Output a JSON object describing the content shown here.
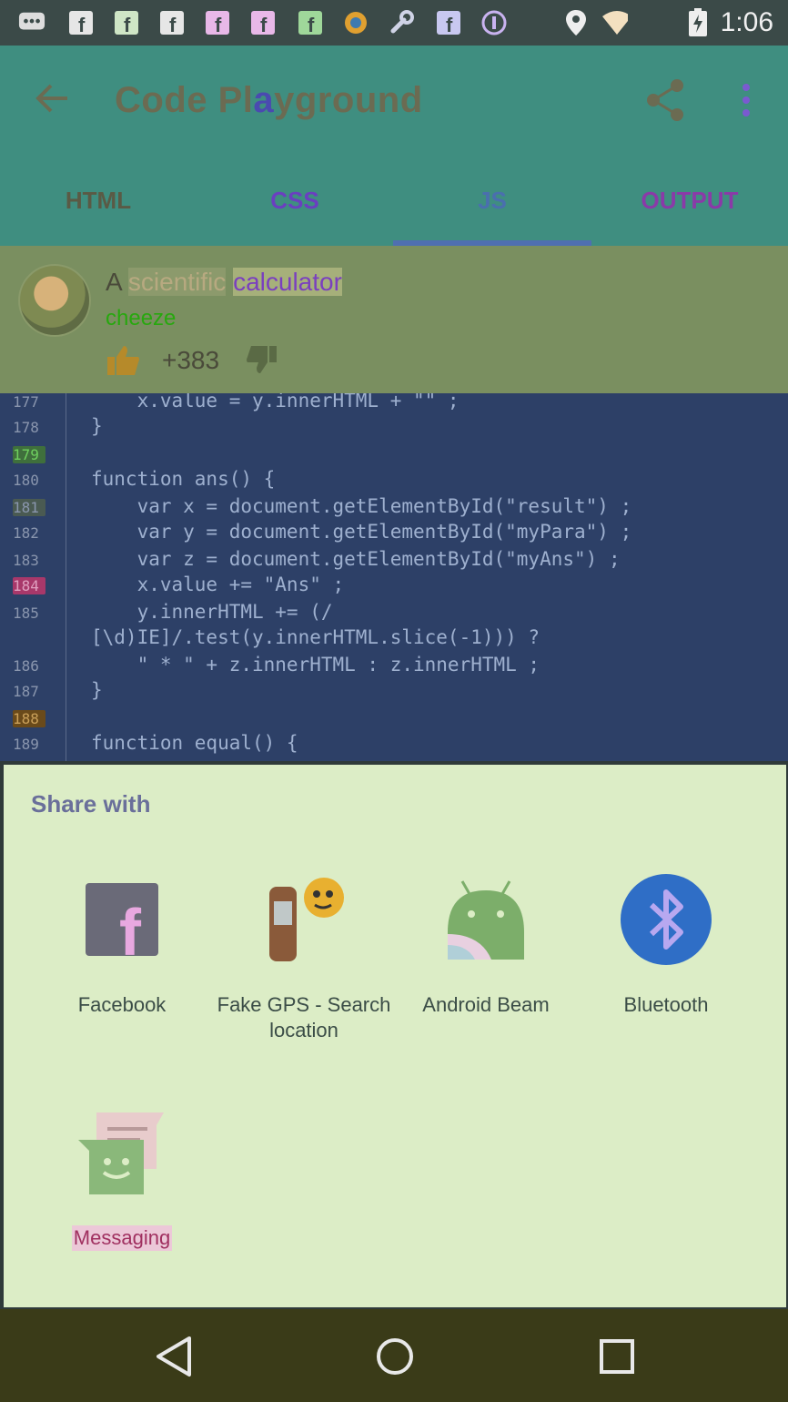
{
  "status_bar": {
    "time": "1:06",
    "notification_icons": [
      "chat-icon",
      "facebook-icon",
      "facebook-icon",
      "facebook-icon",
      "facebook-icon",
      "facebook-icon",
      "gear-app-icon",
      "wrench-icon",
      "facebook-icon",
      "tor-icon"
    ],
    "system_icons": [
      "location-icon",
      "wifi-icon",
      "battery-charging-icon"
    ]
  },
  "app_bar": {
    "title_part1": "Code Pl",
    "title_highlight": "a",
    "title_part2": "yground",
    "tabs": [
      {
        "label": "HTML",
        "color": "#5a5a45"
      },
      {
        "label": "CSS",
        "color": "#6a3fc0"
      },
      {
        "label": "JS",
        "color": "#4a6fae"
      },
      {
        "label": "OUTPUT",
        "color": "#8a3aa8"
      }
    ],
    "active_tab": "JS"
  },
  "post": {
    "title_prefix": "A ",
    "title_word1": "scientific",
    "title_word2": "calculator",
    "author": "cheeze",
    "votes": "+383"
  },
  "editor": {
    "lines": [
      {
        "no": "177",
        "code": "    x.value = y.innerHTML + \"\" ;"
      },
      {
        "no": "178",
        "code": "}"
      },
      {
        "no": "179",
        "code": ""
      },
      {
        "no": "180",
        "code": "function ans() {"
      },
      {
        "no": "181",
        "code": "    var x = document.getElementById(\"result\") ;"
      },
      {
        "no": "182",
        "code": "    var y = document.getElementById(\"myPara\") ;"
      },
      {
        "no": "183",
        "code": "    var z = document.getElementById(\"myAns\") ;"
      },
      {
        "no": "184",
        "code": "    x.value += \"Ans\" ;"
      },
      {
        "no": "185",
        "code": "    y.innerHTML += (/"
      },
      {
        "no": "",
        "code": "[\\d)IE]/.test(y.innerHTML.slice(-1))) ?"
      },
      {
        "no": "186",
        "code": "    \" * \" + z.innerHTML : z.innerHTML ;"
      },
      {
        "no": "187",
        "code": "}"
      },
      {
        "no": "188",
        "code": ""
      },
      {
        "no": "189",
        "code": "function equal() {"
      }
    ]
  },
  "share_sheet": {
    "title": "Share with",
    "apps": [
      {
        "label": "Facebook",
        "icon": "facebook-app-icon"
      },
      {
        "label": "Fake GPS - Search location",
        "icon": "gps-app-icon"
      },
      {
        "label": "Android Beam",
        "icon": "android-beam-icon"
      },
      {
        "label": "Bluetooth",
        "icon": "bluetooth-icon"
      },
      {
        "label": "Messaging",
        "icon": "messaging-icon"
      }
    ]
  },
  "nav_bar": {
    "buttons": [
      "back-nav-icon",
      "home-nav-icon",
      "recents-nav-icon"
    ]
  }
}
